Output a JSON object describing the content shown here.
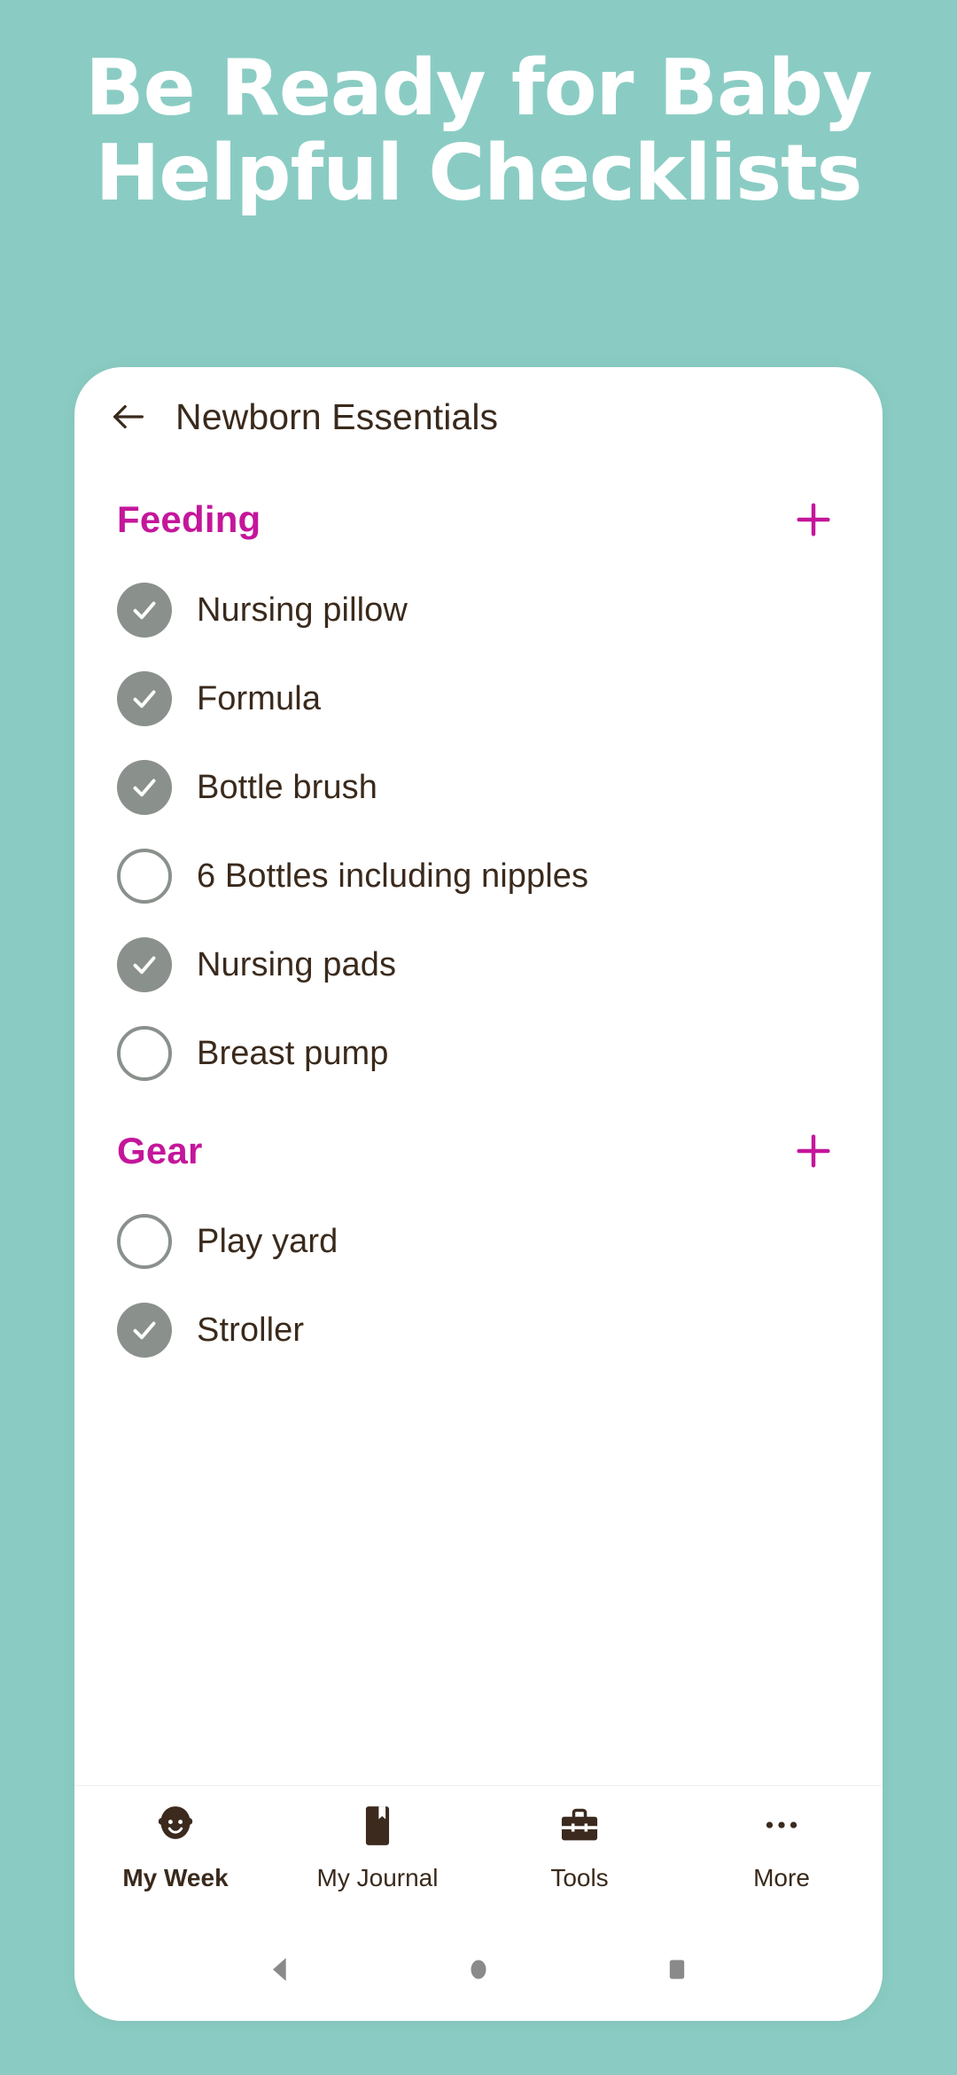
{
  "hero": {
    "line1": "Be Ready for Baby",
    "line2": "Helpful Checklists",
    "text_color": "#FFFFFF",
    "background_color": "#8ACCC3"
  },
  "appbar": {
    "back_label": "Back",
    "title": "Newborn Essentials"
  },
  "theme": {
    "accent": "#C4169B",
    "text": "#3A2A1C",
    "checkbox_gray": "#8A918C",
    "card_background": "#FFFFFF"
  },
  "sections": [
    {
      "title": "Feeding",
      "add_label": "+",
      "items": [
        {
          "label": "Nursing pillow",
          "checked": true
        },
        {
          "label": "Formula",
          "checked": true
        },
        {
          "label": "Bottle brush",
          "checked": true
        },
        {
          "label": "6 Bottles including nipples",
          "checked": false
        },
        {
          "label": "Nursing pads",
          "checked": true
        },
        {
          "label": "Breast pump",
          "checked": false
        }
      ]
    },
    {
      "title": "Gear",
      "add_label": "+",
      "items": [
        {
          "label": "Play yard",
          "checked": false
        },
        {
          "label": "Stroller",
          "checked": true
        }
      ]
    }
  ],
  "tabbar": {
    "tabs": [
      {
        "label": "My Week",
        "icon": "baby-face-icon",
        "active": true
      },
      {
        "label": "My Journal",
        "icon": "journal-book-icon",
        "active": false
      },
      {
        "label": "Tools",
        "icon": "toolbox-icon",
        "active": false
      },
      {
        "label": "More",
        "icon": "more-dots-icon",
        "active": false
      }
    ]
  },
  "system_nav": {
    "back": "Back",
    "home": "Home",
    "recents": "Recents"
  }
}
